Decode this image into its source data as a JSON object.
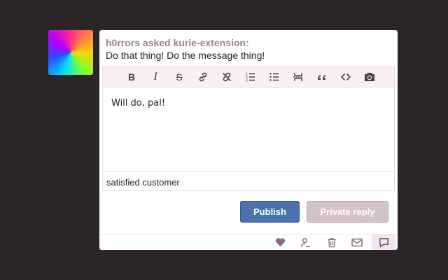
{
  "post": {
    "asker_line": "h0rrors asked kurie-extension:",
    "question": "Do that thing! Do the message thing!"
  },
  "toolbar": {
    "items": [
      {
        "name": "bold-icon",
        "label": "B"
      },
      {
        "name": "italic-icon",
        "label": "I"
      },
      {
        "name": "strikethrough-icon",
        "label": "S"
      },
      {
        "name": "link-icon"
      },
      {
        "name": "unlink-icon"
      },
      {
        "name": "ordered-list-icon"
      },
      {
        "name": "unordered-list-icon"
      },
      {
        "name": "read-more-icon"
      },
      {
        "name": "blockquote-icon"
      },
      {
        "name": "html-code-icon"
      },
      {
        "name": "camera-icon"
      }
    ]
  },
  "editor": {
    "answer_text": "Will do, pal!",
    "tags_value": "satisfied customer"
  },
  "actions": {
    "publish_label": "Publish",
    "private_reply_label": "Private reply"
  },
  "footer": {
    "icons": [
      "heart-icon",
      "user-edit-icon",
      "trash-icon",
      "mail-icon",
      "reply-icon"
    ],
    "active_icon": "reply-icon",
    "icon_color": "#8a6a86"
  }
}
